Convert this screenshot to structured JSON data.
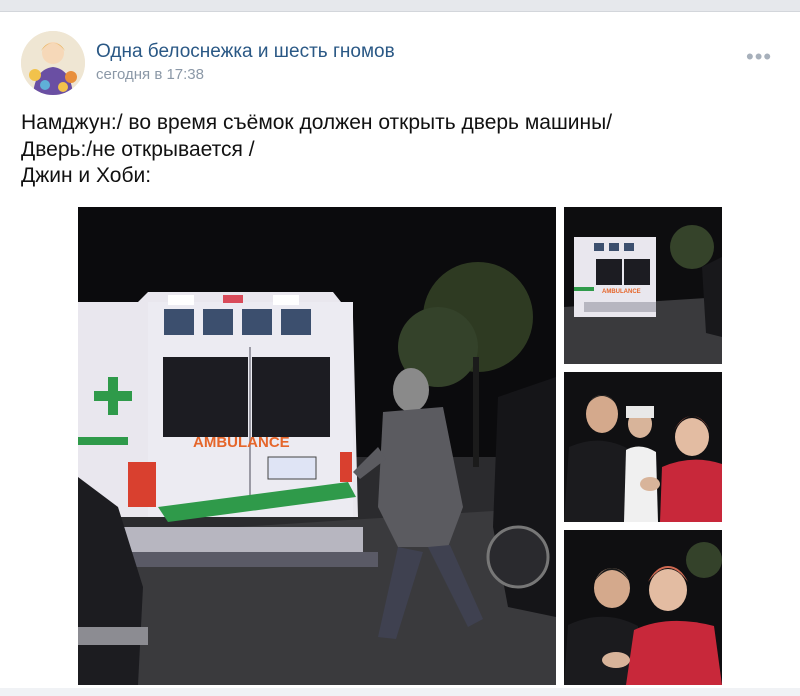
{
  "post": {
    "author": "Одна белоснежка и шесть гномов",
    "time": "сегодня в 17:38",
    "menu_icon": "more-horizontal-icon",
    "text_lines": [
      "Намджун:/ во время съёмок должен открыть дверь машины/",
      "Дверь:/не открывается /",
      "Джин и Хоби:"
    ]
  },
  "photos": {
    "main_sign": "AMBULANCE",
    "thumb1_sign": "AMBULANCE"
  },
  "colors": {
    "link": "#2a5885",
    "meta": "#8b98a7",
    "ambulance_stripe": "#2f9a4a",
    "ambulance_text": "#e5662b",
    "red_jacket": "#c8283a"
  }
}
